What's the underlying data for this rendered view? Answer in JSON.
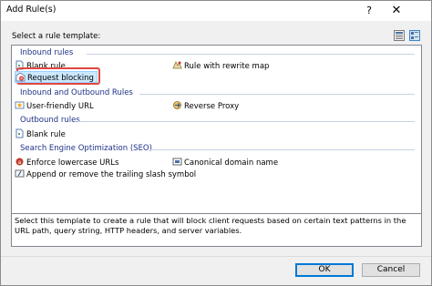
{
  "window": {
    "title": "Add Rule(s)",
    "help_glyph": "?",
    "close_glyph": "✕"
  },
  "prompt": "Select a rule template:",
  "view_buttons": [
    "details-view-icon",
    "tile-view-icon"
  ],
  "groups": {
    "inbound": {
      "header": "Inbound rules",
      "items": {
        "blank_rule": "Blank rule",
        "rewrite_map": "Rule with rewrite map",
        "request_blocking": "Request blocking"
      }
    },
    "inout": {
      "header": "Inbound and Outbound Rules",
      "items": {
        "user_friendly": "User-friendly URL",
        "reverse_proxy": "Reverse Proxy"
      }
    },
    "outbound": {
      "header": "Outbound rules",
      "items": {
        "blank_rule": "Blank rule"
      }
    },
    "seo": {
      "header": "Search Engine Optimization (SEO)",
      "items": {
        "lowercase": "Enforce lowercase URLs",
        "canonical": "Canonical domain name",
        "trailing_slash": "Append or remove the trailing slash symbol"
      }
    }
  },
  "selected_item": "Request blocking",
  "description": "Select this template to create a rule that will block client requests based on certain text patterns in the URL path, query string, HTTP headers, and server variables.",
  "buttons": {
    "ok": "OK",
    "cancel": "Cancel"
  },
  "colors": {
    "group_header": "#1e3287",
    "selection": "#cce8ff",
    "annotation_box": "#e0473f",
    "default_button_border": "#0078d7"
  }
}
